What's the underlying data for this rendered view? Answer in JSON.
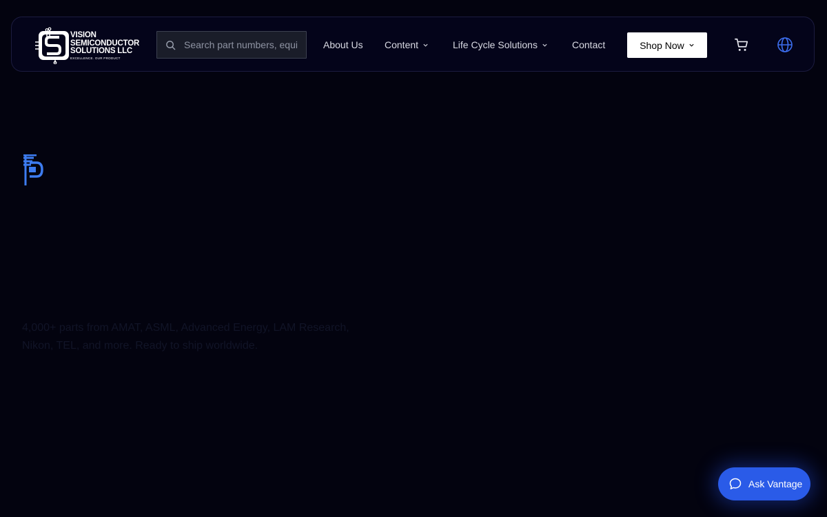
{
  "header": {
    "logo": {
      "line1": "VISION",
      "line2": "SEMICONDUCTOR",
      "line3": "SOLUTIONS LLC",
      "tagline": "EXCELLENCE. OUR PRODUCT",
      "icon": "circuit-logo-icon"
    },
    "search": {
      "placeholder": "Search part numbers, equipment...",
      "value": "",
      "icon": "search-icon"
    },
    "nav": {
      "about": "About Us",
      "content": "Content",
      "lifecycle": "Life Cycle Solutions",
      "contact": "Contact"
    },
    "shop_label": "Shop Now",
    "cart_icon": "cart-icon",
    "language_icon": "globe-icon"
  },
  "hero": {
    "description": "4,000+ parts from AMAT, ASML, Advanced Energy, LAM Research, Nikon, TEL, and more. Ready to ship worldwide."
  },
  "chat": {
    "label": "Ask Vantage",
    "icon": "chat-bubble-icon"
  },
  "colors": {
    "background": "#03030f",
    "accent": "#2a5be8",
    "hero_icon": "#3d7cf0",
    "nav_border": "#1c1c40"
  }
}
